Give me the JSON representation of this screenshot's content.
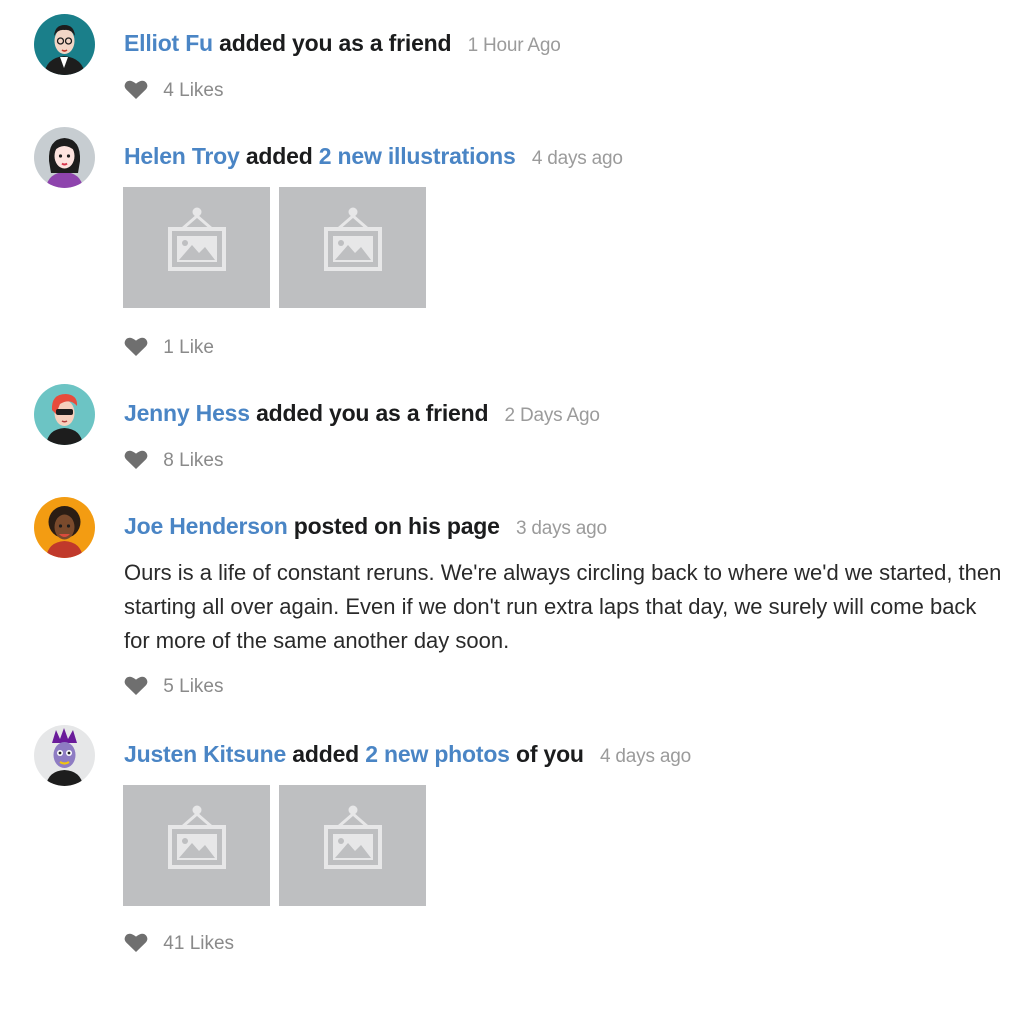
{
  "events": [
    {
      "user": "Elliot Fu",
      "action": "added you as a friend",
      "date": "1 Hour Ago",
      "likes": "4 Likes"
    },
    {
      "user": "Helen Troy",
      "action": "added",
      "link": "2 new illustrations",
      "date": "4 days ago",
      "likes": "1 Like"
    },
    {
      "user": "Jenny Hess",
      "action": "added you as a friend",
      "date": "2 Days Ago",
      "likes": "8 Likes"
    },
    {
      "user": "Joe Henderson",
      "action": "posted on his page",
      "date": "3 days ago",
      "text": "Ours is a life of constant reruns. We're always circling back to where we'd we started, then starting all over again. Even if we don't run extra laps that day, we surely will come back for more of the same another day soon.",
      "likes": "5 Likes"
    },
    {
      "user": "Justen Kitsune",
      "action": "added",
      "link": "2 new photos",
      "action_suffix": "of you",
      "date": "4 days ago",
      "likes": "41 Likes"
    }
  ],
  "icons": {
    "like": "heart-icon",
    "image": "image-placeholder-icon"
  },
  "colors": {
    "link": "#4a85c5",
    "date": "#9b9b9b",
    "meta": "#8a8a8a",
    "placeholder": "#bebfc1"
  }
}
